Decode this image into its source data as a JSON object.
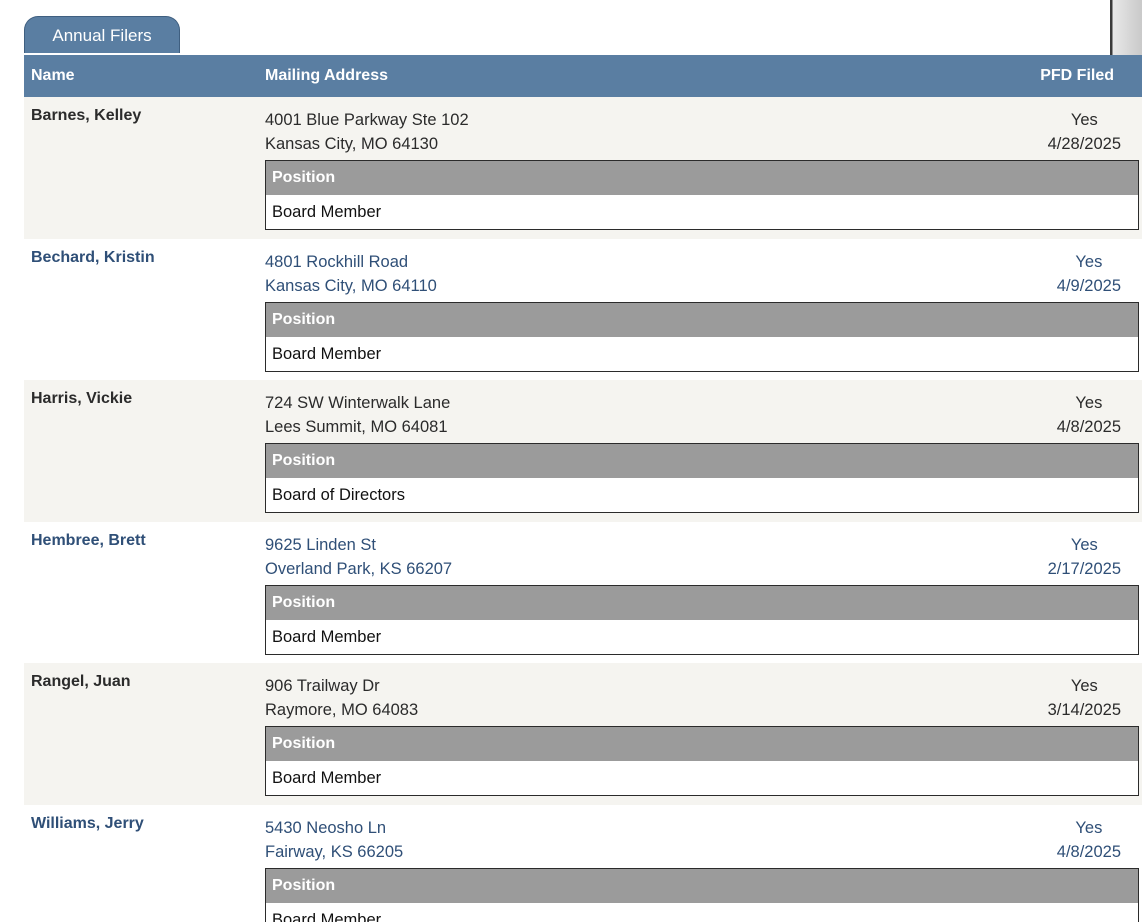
{
  "tab": {
    "label": "Annual Filers"
  },
  "table": {
    "headers": {
      "name": "Name",
      "address": "Mailing Address",
      "pfd": "PFD Filed"
    },
    "rows": [
      {
        "name": "Barnes, Kelley",
        "address_line1": "4001 Blue Parkway Ste 102",
        "address_line2": "Kansas City, MO 64130",
        "pfd_status": "Yes",
        "pfd_date": "4/28/2025",
        "position_header": "Position",
        "position": "Board Member"
      },
      {
        "name": "Bechard, Kristin",
        "address_line1": "4801 Rockhill Road",
        "address_line2": "Kansas City, MO 64110",
        "pfd_status": "Yes",
        "pfd_date": "4/9/2025",
        "position_header": "Position",
        "position": "Board Member"
      },
      {
        "name": "Harris, Vickie",
        "address_line1": "724 SW Winterwalk Lane",
        "address_line2": "Lees Summit, MO 64081",
        "pfd_status": "Yes",
        "pfd_date": "4/8/2025",
        "position_header": "Position",
        "position": "Board of Directors"
      },
      {
        "name": "Hembree, Brett",
        "address_line1": "9625 Linden St",
        "address_line2": "Overland Park, KS 66207",
        "pfd_status": "Yes",
        "pfd_date": "2/17/2025",
        "position_header": "Position",
        "position": "Board Member"
      },
      {
        "name": "Rangel, Juan",
        "address_line1": "906 Trailway Dr",
        "address_line2": "Raymore, MO 64083",
        "pfd_status": "Yes",
        "pfd_date": "3/14/2025",
        "position_header": "Position",
        "position": "Board Member"
      },
      {
        "name": "Williams, Jerry",
        "address_line1": "5430 Neosho Ln",
        "address_line2": "Fairway, KS 66205",
        "pfd_status": "Yes",
        "pfd_date": "4/8/2025",
        "position_header": "Position",
        "position": "Board Member"
      }
    ]
  },
  "colors": {
    "header_blue": "#5a7ea2",
    "position_header_gray": "#9b9b9b",
    "row_alt_bg": "#f5f4f0",
    "link_blue": "#2f4f77"
  }
}
